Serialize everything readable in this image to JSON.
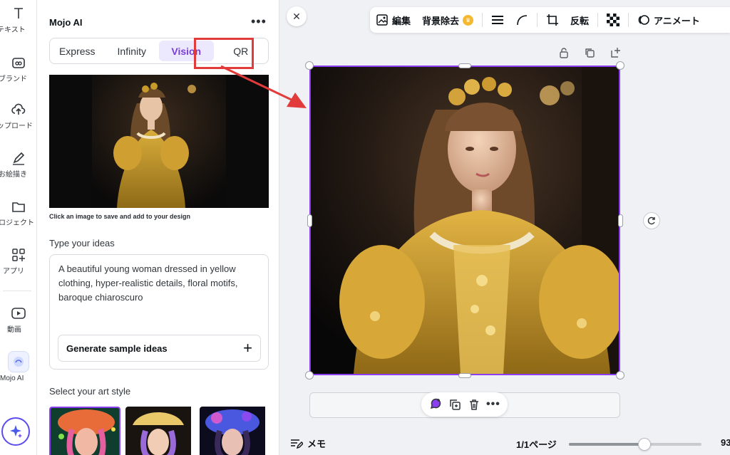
{
  "rail": {
    "items": [
      {
        "label": "テキスト",
        "icon": "text-icon"
      },
      {
        "label": "ブランド",
        "icon": "brand-icon"
      },
      {
        "label": "アップロード",
        "icon": "upload-icon"
      },
      {
        "label": "お絵描き",
        "icon": "draw-icon"
      },
      {
        "label": "プロジェクト",
        "icon": "folder-icon"
      },
      {
        "label": "アプリ",
        "icon": "apps-icon"
      },
      {
        "label": "動画",
        "icon": "video-icon"
      },
      {
        "label": "Mojo AI",
        "icon": "mojo-ai-icon"
      }
    ]
  },
  "panel": {
    "title": "Mojo AI",
    "more": "•••",
    "tabs": [
      "Express",
      "Infinity",
      "Vision",
      "QR"
    ],
    "active_tab": "Vision",
    "caption": "Click an image to save and add to your design",
    "ideas_label": "Type your ideas",
    "ideas_text": "A beautiful young woman dressed in yellow clothing, hyper-realistic details, floral motifs, baroque chiaroscuro",
    "generate_label": "Generate sample ideas",
    "plus": "+",
    "style_label": "Select your art style"
  },
  "toolbar": {
    "edit": "編集",
    "bg_remove": "背景除去",
    "flip": "反転",
    "animate": "アニメート"
  },
  "canvas": {
    "close": "✕"
  },
  "footer": {
    "memo": "メモ",
    "pages": "1/1ページ",
    "zoom": "93",
    "zoom_level": 0.57
  },
  "colors": {
    "accent": "#8b3df0",
    "highlight": "#e23b3b",
    "crown": "#f5b82e"
  }
}
